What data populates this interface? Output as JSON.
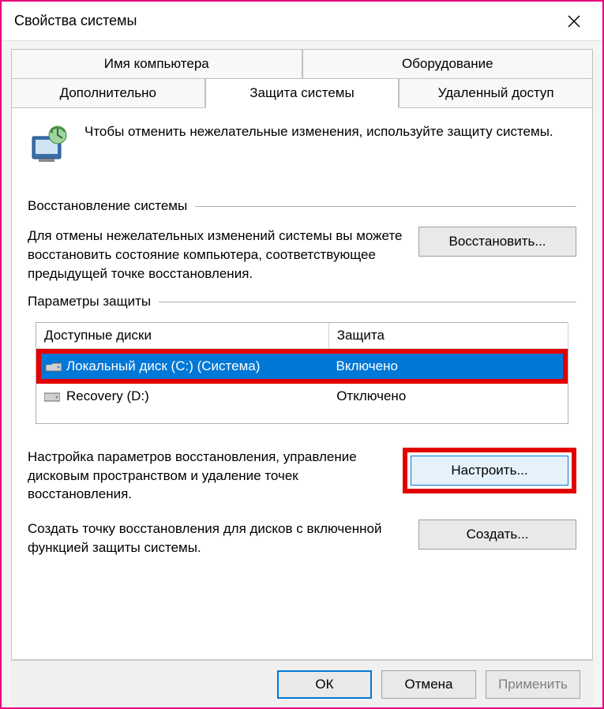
{
  "window": {
    "title": "Свойства системы"
  },
  "tabs": {
    "row1": [
      {
        "label": "Имя компьютера"
      },
      {
        "label": "Оборудование"
      }
    ],
    "row2": [
      {
        "label": "Дополнительно"
      },
      {
        "label": "Защита системы",
        "active": true
      },
      {
        "label": "Удаленный доступ"
      }
    ]
  },
  "intro": {
    "text": "Чтобы отменить нежелательные изменения, используйте защиту системы."
  },
  "restore": {
    "heading": "Восстановление системы",
    "text": "Для отмены нежелательных изменений системы вы можете восстановить состояние компьютера, соответствующее предыдущей точке восстановления.",
    "button": "Восстановить..."
  },
  "protection": {
    "heading": "Параметры защиты",
    "columns": {
      "drive": "Доступные диски",
      "status": "Защита"
    },
    "rows": [
      {
        "drive": "Локальный диск (C:) (Система)",
        "status": "Включено",
        "selected": true,
        "highlighted": true
      },
      {
        "drive": "Recovery (D:)",
        "status": "Отключено",
        "selected": false
      }
    ]
  },
  "configure": {
    "text": "Настройка параметров восстановления, управление дисковым пространством и удаление точек восстановления.",
    "button": "Настроить..."
  },
  "create": {
    "text": "Создать точку восстановления для дисков с включенной функцией защиты системы.",
    "button": "Создать..."
  },
  "footer": {
    "ok": "ОК",
    "cancel": "Отмена",
    "apply": "Применить"
  }
}
